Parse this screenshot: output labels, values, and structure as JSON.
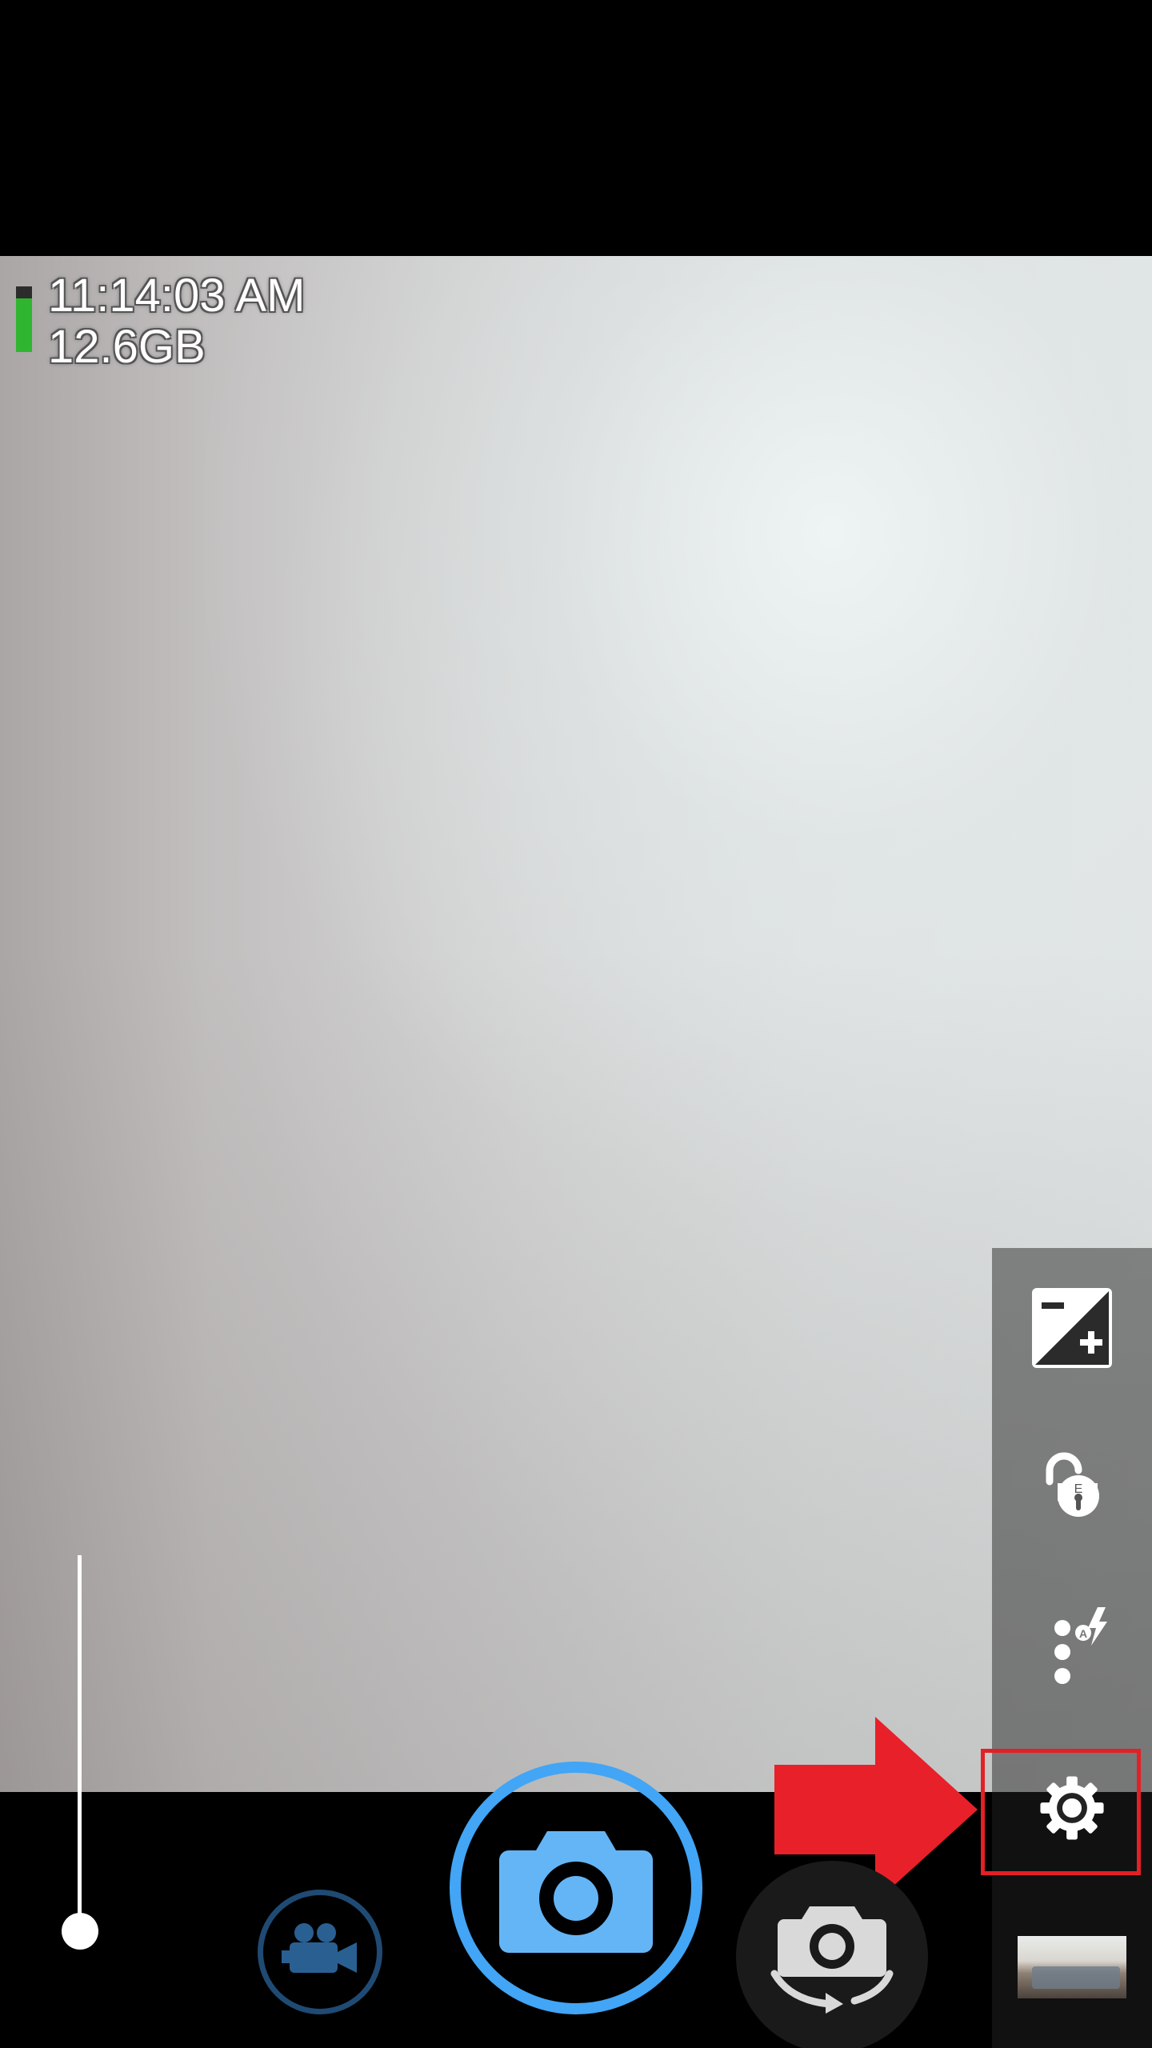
{
  "status": {
    "time": "11:14:03 AM",
    "storage_free": "12.6GB",
    "battery_level": 0.82
  },
  "zoom": {
    "level": 0.0
  },
  "side_panel": {
    "buttons": [
      {
        "name": "exposure-compensation",
        "icon": "exposure-plus-minus-icon"
      },
      {
        "name": "exposure-lock",
        "icon": "unlocked-padlock-icon"
      },
      {
        "name": "flash-mode",
        "icon": "flash-auto-icon"
      },
      {
        "name": "settings",
        "icon": "gear-icon"
      }
    ]
  },
  "controls": {
    "shutter_icon": "camera-icon",
    "video_icon": "video-camera-icon",
    "switch_icon": "switch-camera-icon",
    "gallery_icon": "gallery-thumbnail"
  },
  "annotation": {
    "highlight_color": "#e32025",
    "target": "settings"
  },
  "colors": {
    "accent": "#42a5f5",
    "video_accent": "#1f4a73",
    "battery": "#2fb52f"
  }
}
